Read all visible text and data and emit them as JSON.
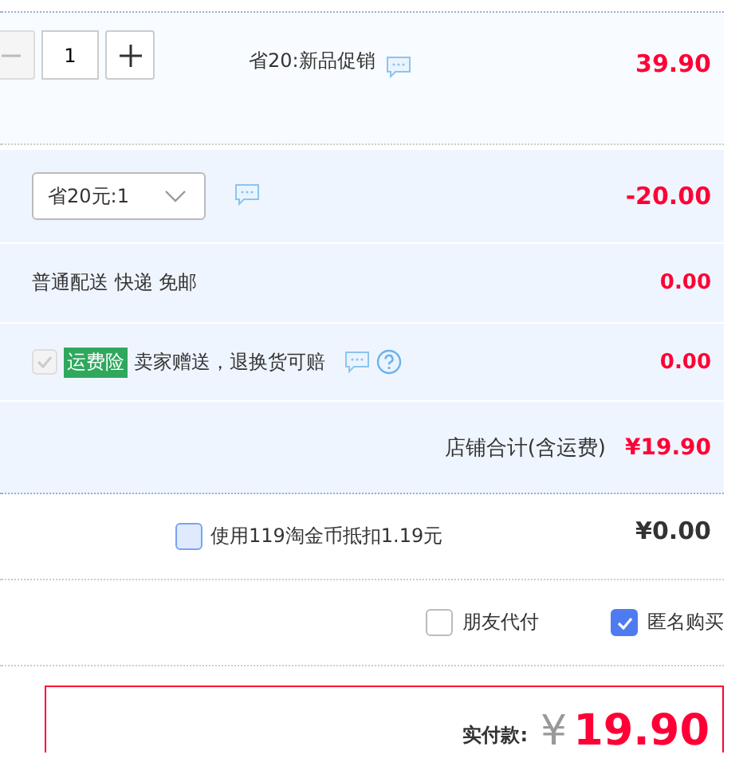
{
  "cart_item": {
    "quantity": "1",
    "promotion": "省20:新品促销",
    "price": "39.90"
  },
  "coupon": {
    "value": "省20元:1",
    "amount": "-20.00"
  },
  "shipping": {
    "label": "普通配送 快递 免邮",
    "amount": "0.00"
  },
  "insurance": {
    "checked": true,
    "disabled": true,
    "tag": "运费险",
    "label": "卖家赠送，退换货可赔",
    "amount": "0.00"
  },
  "store_total": {
    "label": "店铺合计(含运费)",
    "amount": "¥19.90"
  },
  "coins": {
    "checked": false,
    "label": "使用119淘金币抵扣1.19元",
    "amount": "¥0.00"
  },
  "options": [
    {
      "label": "朋友代付",
      "checked": false
    },
    {
      "label": "匿名购买",
      "checked": true
    }
  ],
  "payment": {
    "label": "实付款:",
    "currency": "¥",
    "amount": "19.90"
  }
}
